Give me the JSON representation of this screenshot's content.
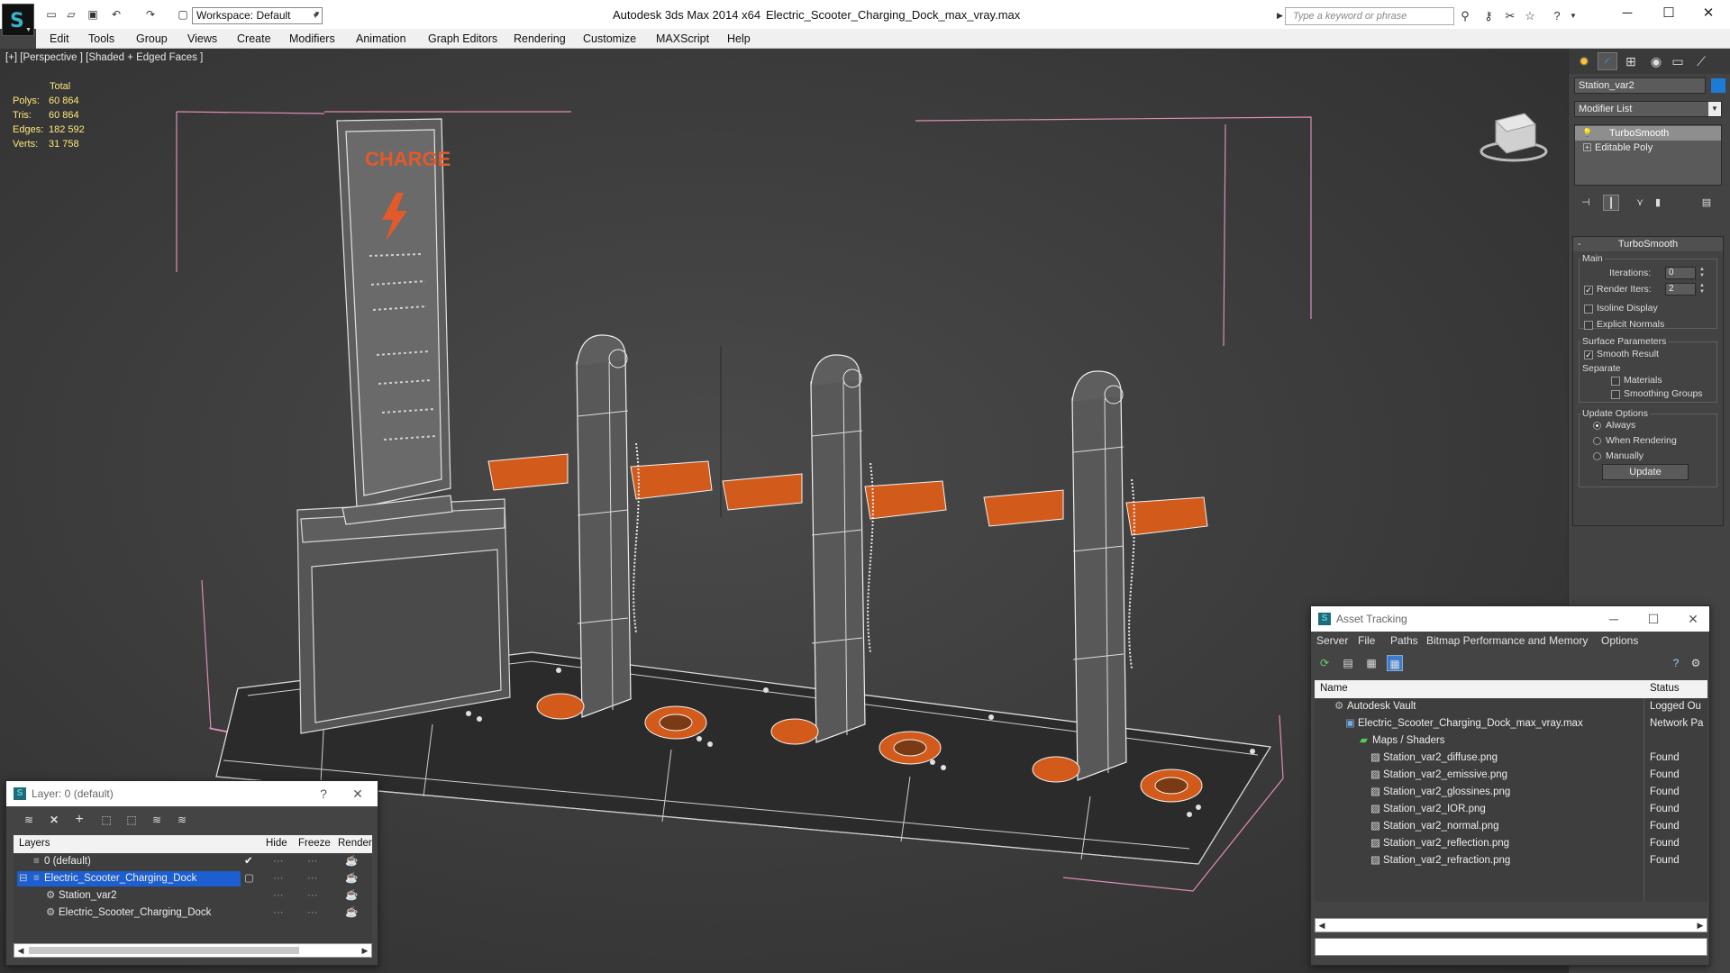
{
  "app": {
    "title": "Autodesk 3ds Max  2014 x64",
    "filename": "Electric_Scooter_Charging_Dock_max_vray.max",
    "workspace": "Workspace: Default",
    "search_placeholder": "Type a keyword or phrase"
  },
  "menu": [
    "Edit",
    "Tools",
    "Group",
    "Views",
    "Create",
    "Modifiers",
    "Animation",
    "Graph Editors",
    "Rendering",
    "Customize",
    "MAXScript",
    "Help"
  ],
  "viewport": {
    "label": "[+] [Perspective ] [Shaded + Edged Faces ]",
    "stats": {
      "header": "Total",
      "rows": [
        {
          "k": "Polys:",
          "v": "60 864"
        },
        {
          "k": "Tris:",
          "v": "60 864"
        },
        {
          "k": "Edges:",
          "v": "182 592"
        },
        {
          "k": "Verts:",
          "v": "31 758"
        }
      ]
    },
    "sign_text": "CHARGE"
  },
  "command_panel": {
    "tabs": [
      "create-tab-icon",
      "modify-tab-icon",
      "hierarchy-tab-icon",
      "motion-tab-icon",
      "display-tab-icon",
      "utilities-tab-icon"
    ],
    "object_name": "Station_var2",
    "object_color": "#1c7bd4",
    "modifier_list": "Modifier List",
    "stack": [
      "TurboSmooth",
      "Editable Poly"
    ],
    "turbosmooth": {
      "title": "TurboSmooth",
      "main_label": "Main",
      "iterations_label": "Iterations:",
      "iterations": "0",
      "render_iters_label": "Render Iters:",
      "render_iters": "2",
      "isoline": "Isoline Display",
      "explicit": "Explicit Normals",
      "surface_label": "Surface Parameters",
      "smooth_result": "Smooth Result",
      "separate_label": "Separate",
      "materials": "Materials",
      "smoothing_groups": "Smoothing Groups",
      "update_options": "Update Options",
      "always": "Always",
      "when_rendering": "When Rendering",
      "manually": "Manually",
      "update_button": "Update"
    }
  },
  "layer_window": {
    "title": "Layer: 0 (default)",
    "help": "?",
    "columns": {
      "layers": "Layers",
      "hide": "Hide",
      "freeze": "Freeze",
      "render": "Render"
    },
    "rows": [
      {
        "name": "0 (default)"
      },
      {
        "name": "Electric_Scooter_Charging_Dock"
      },
      {
        "name": "Station_var2"
      },
      {
        "name": "Electric_Scooter_Charging_Dock"
      }
    ]
  },
  "asset_tracking": {
    "title": "Asset Tracking",
    "menu": [
      "Server",
      "File",
      "Paths",
      "Bitmap Performance and Memory",
      "Options"
    ],
    "columns": {
      "name": "Name",
      "status": "Status"
    },
    "rows": [
      {
        "name": "Autodesk Vault",
        "status": "Logged Ou"
      },
      {
        "name": "Electric_Scooter_Charging_Dock_max_vray.max",
        "status": "Network Pa"
      },
      {
        "name": "Maps / Shaders",
        "status": ""
      },
      {
        "name": "Station_var2_diffuse.png",
        "status": "Found"
      },
      {
        "name": "Station_var2_emissive.png",
        "status": "Found"
      },
      {
        "name": "Station_var2_glossines.png",
        "status": "Found"
      },
      {
        "name": "Station_var2_IOR.png",
        "status": "Found"
      },
      {
        "name": "Station_var2_normal.png",
        "status": "Found"
      },
      {
        "name": "Station_var2_reflection.png",
        "status": "Found"
      },
      {
        "name": "Station_var2_refraction.png",
        "status": "Found"
      }
    ]
  }
}
